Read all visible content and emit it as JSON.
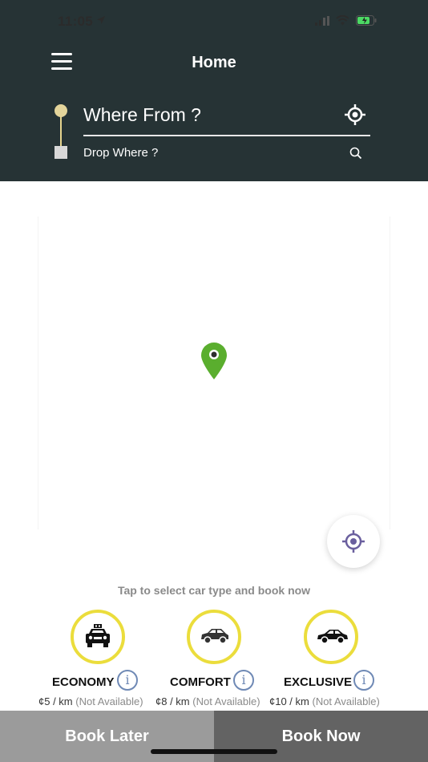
{
  "status_bar": {
    "time": "11:05"
  },
  "header": {
    "title": "Home"
  },
  "route": {
    "from_placeholder": "Where From ?",
    "drop_placeholder": "Drop Where ?"
  },
  "map": {
    "hint": "Tap to select car type and book now"
  },
  "car_types": [
    {
      "name": "ECONOMY",
      "price": "¢5 / km",
      "availability": "(Not Available)",
      "icon": "taxi-icon"
    },
    {
      "name": "COMFORT",
      "price": "¢8 / km",
      "availability": "(Not Available)",
      "icon": "hatchback-icon"
    },
    {
      "name": "EXCLUSIVE",
      "price": "¢10 / km",
      "availability": "(Not Available)",
      "icon": "sedan-icon"
    }
  ],
  "actions": {
    "book_later": "Book Later",
    "book_now": "Book Now"
  },
  "colors": {
    "header_bg": "#263335",
    "accent_ring": "#ebdd3c",
    "pin_green": "#5aae2e",
    "info_blue": "#6f89b5"
  }
}
